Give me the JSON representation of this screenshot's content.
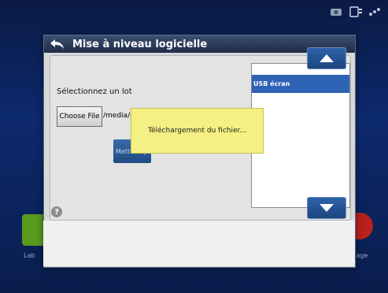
{
  "dialog": {
    "title": "Mise à niveau logicielle",
    "select_label": "Sélectionnez un lot",
    "choose_file_label": "Choose File",
    "file_path": "/media/sd",
    "update_button_label": "Mettre à jour",
    "help_label": "?"
  },
  "list": {
    "items": [
      "USB écran"
    ]
  },
  "toast": {
    "message": "Téléchargement du fichier..."
  },
  "background": {
    "left_app_label": "Lab",
    "right_app_label": "llage"
  },
  "colors": {
    "accent": "#2f63b6",
    "toast": "#f4f083",
    "title_bar": "#1e2d47"
  },
  "icons": {
    "back": "back-arrow-icon",
    "up": "up-arrow-icon",
    "down": "down-arrow-icon",
    "status": [
      "camera-icon",
      "device-icon",
      "signal-icon"
    ]
  }
}
